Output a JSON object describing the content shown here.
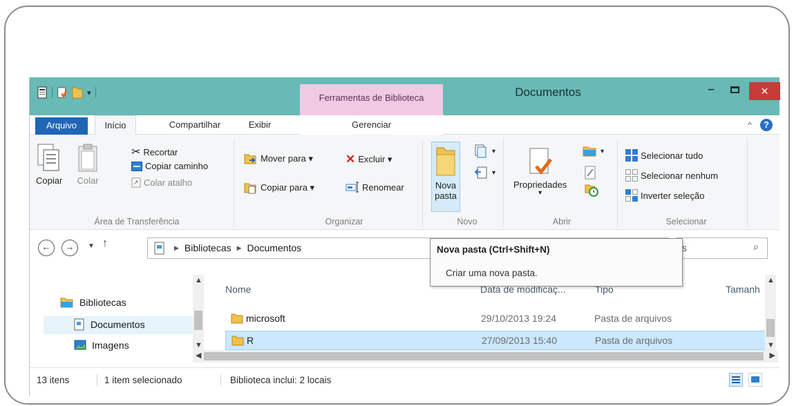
{
  "window": {
    "title": "Documentos",
    "contextual_tab_label": "Ferramentas de Biblioteca",
    "close_glyph": "×"
  },
  "tabs": {
    "file": "Arquivo",
    "home": "Início",
    "share": "Compartilhar",
    "view": "Exibir",
    "manage": "Gerenciar"
  },
  "ribbon": {
    "clipboard": {
      "label": "Área de Transferência",
      "copy": "Copiar",
      "paste": "Colar",
      "cut": "Recortar",
      "copy_path": "Copiar caminho",
      "paste_shortcut": "Colar atalho"
    },
    "organize": {
      "label": "Organizar",
      "move_to": "Mover para ▾",
      "copy_to": "Copiar para ▾",
      "delete": "Excluir ▾",
      "rename": "Renomear"
    },
    "new": {
      "label": "Novo",
      "new_folder_line1": "Nova",
      "new_folder_line2": "pasta"
    },
    "open": {
      "label": "Abrir",
      "properties": "Propriedades"
    },
    "select": {
      "label": "Selecionar",
      "select_all": "Selecionar tudo",
      "select_none": "Selecionar nenhum",
      "invert": "Inverter seleção"
    }
  },
  "address": {
    "crumbs": [
      "Bibliotecas",
      "Documentos"
    ],
    "search_fragment": "s"
  },
  "tooltip": {
    "title": "Nova pasta (Ctrl+Shift+N)",
    "description": "Criar uma nova pasta."
  },
  "nav_pane": {
    "items": [
      "Bibliotecas",
      "Documentos",
      "Imagens"
    ],
    "selected": "Documentos"
  },
  "file_list": {
    "columns": [
      "Nome",
      "Data de modificaç...",
      "Tipo",
      "Tamanh"
    ],
    "rows": [
      {
        "name": "microsoft",
        "date": "29/10/2013 19:24",
        "type": "Pasta de arquivos",
        "selected": false
      },
      {
        "name": "R",
        "date": "27/09/2013 15:40",
        "type": "Pasta de arquivos",
        "selected": true
      }
    ]
  },
  "status": {
    "count": "13 itens",
    "selected": "1 item selecionado",
    "library": "Biblioteca inclui: 2 locais"
  },
  "colors": {
    "titlebar": "#69b9b6",
    "contextual_tab": "#f1c9e3",
    "file_tab": "#1f66b7",
    "close_button": "#c73b38",
    "selection": "#cce8ff",
    "folder": "#f0c24c"
  }
}
